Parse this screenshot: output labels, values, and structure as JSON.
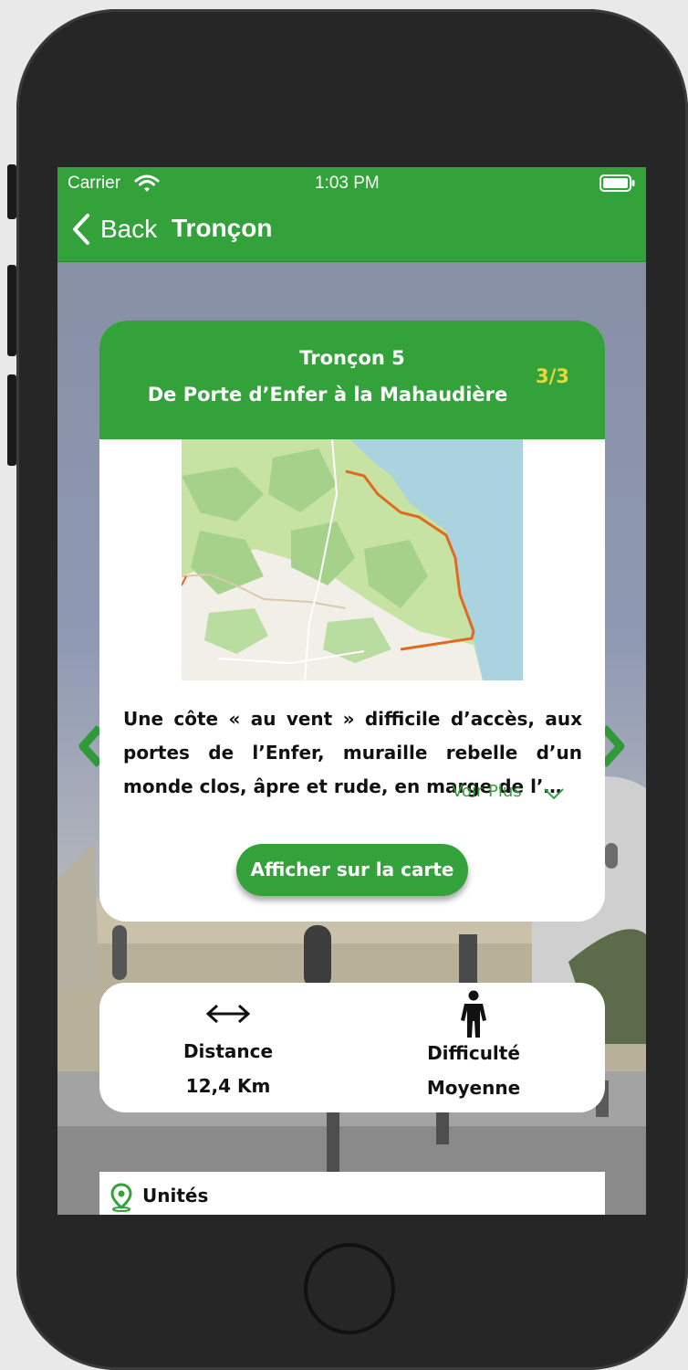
{
  "status_bar": {
    "carrier": "Carrier",
    "time": "1:03 PM"
  },
  "nav": {
    "back_label": "Back",
    "title": "Tronçon"
  },
  "card": {
    "title": "Tronçon 5",
    "subtitle": "De Porte d’Enfer à la Mahaudière",
    "pager": "3/3",
    "description": "Une côte « au vent » difficile d’accès, aux portes de l’Enfer, muraille rebelle d’un monde clos, âpre et rude, en marge de l’…",
    "see_more": "Voir Plus",
    "map_button": "Afficher sur la carte"
  },
  "stats": {
    "distance": {
      "label": "Distance",
      "value": "12,4 Km",
      "icon": "double-arrow-icon"
    },
    "difficulty": {
      "label": "Difficulté",
      "value": "Moyenne",
      "icon": "walker-icon"
    }
  },
  "units": {
    "label": "Unités",
    "icon": "location-pin-icon"
  },
  "colors": {
    "accent": "#33a23a",
    "pager": "#e8d83a",
    "route": "#e06a1e",
    "sea": "#aad3df"
  }
}
